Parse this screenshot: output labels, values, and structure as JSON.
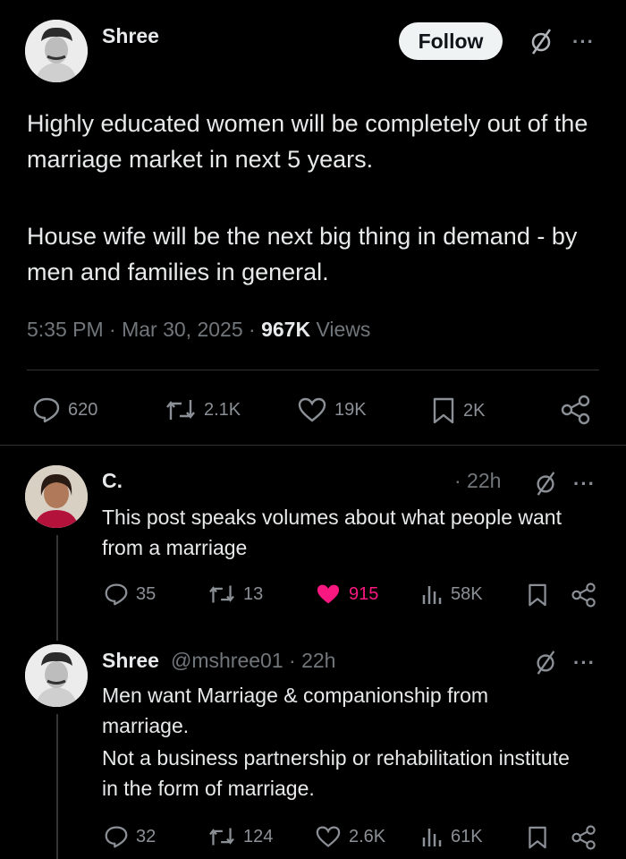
{
  "main_tweet": {
    "author_name": "Shree",
    "follow_label": "Follow",
    "text_line1": "Highly educated women will be completely out of the marriage market in next 5 years.",
    "text_line2": "House wife will be the next big thing in demand - by men and families in general.",
    "time": "5:35 PM · Mar 30, 2025 · ",
    "views_count": "967K",
    "views_label": " Views",
    "replies": "620",
    "reposts": "2.1K",
    "likes": "19K",
    "bookmarks": "2K"
  },
  "reply1": {
    "author_name": "C.",
    "time": "· 22h",
    "text": "This post speaks volumes about what people want from a marriage",
    "replies": "35",
    "reposts": "13",
    "likes": "915",
    "views": "58K",
    "liked_color": "#f91880"
  },
  "reply2": {
    "author_name": "Shree",
    "handle_time": "@mshree01 · 22h",
    "text_line1": "Men want Marriage & companionship from marriage.",
    "text_line2": "Not a business partnership or rehabilitation institute in the form of marriage.",
    "replies": "32",
    "reposts": "124",
    "likes": "2.6K",
    "views": "61K"
  },
  "icons": [
    "mute-icon",
    "more-icon",
    "reply-icon",
    "repost-icon",
    "like-icon",
    "bookmark-icon",
    "share-icon",
    "views-icon"
  ]
}
